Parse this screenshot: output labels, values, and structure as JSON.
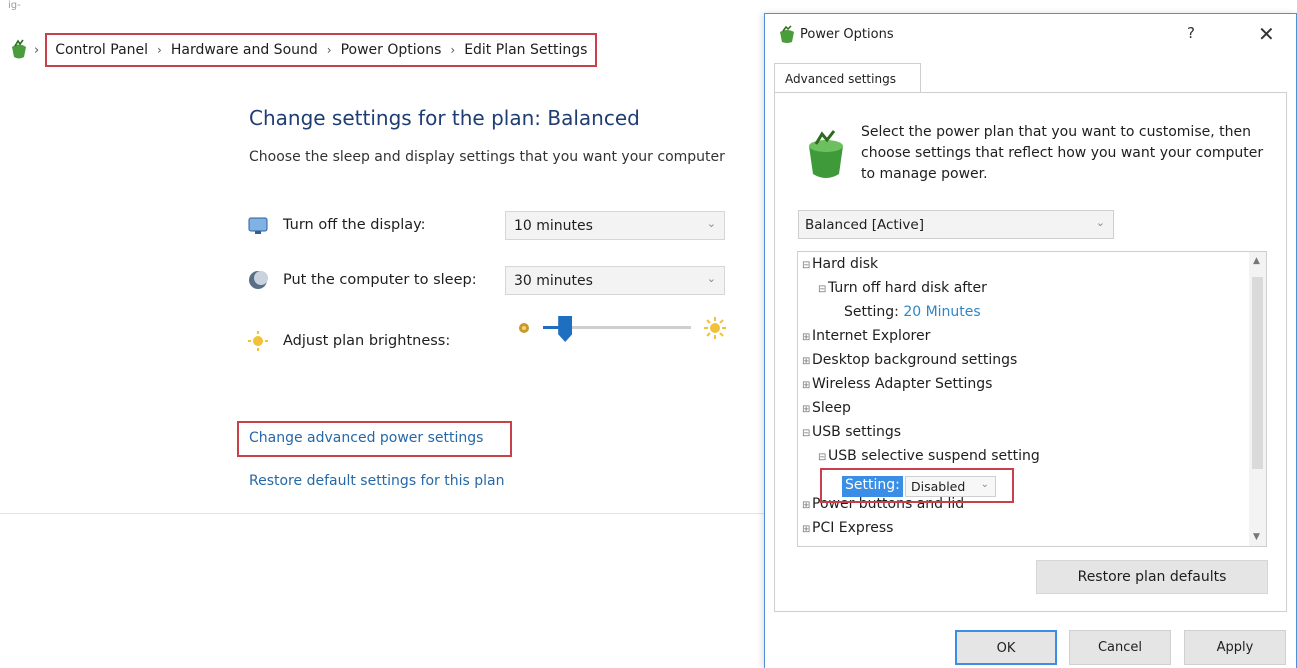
{
  "background": {
    "corner_text": "ig-",
    "breadcrumb": [
      "Control Panel",
      "Hardware and Sound",
      "Power Options",
      "Edit Plan Settings"
    ],
    "title": "Change settings for the plan: Balanced",
    "subtitle": "Choose the sleep and display settings that you want your computer",
    "display_label": "Turn off the display:",
    "display_value": "10 minutes",
    "sleep_label": "Put the computer to sleep:",
    "sleep_value": "30 minutes",
    "brightness_label": "Adjust plan brightness:",
    "brightness_level": 0.15,
    "advanced_link": "Change advanced power settings",
    "restore_link": "Restore default settings for this plan"
  },
  "dialog": {
    "title": "Power Options",
    "help": "?",
    "close": "✕",
    "tab": "Advanced settings",
    "description": "Select the power plan that you want to customise, then choose settings that reflect how you want your computer to manage power.",
    "plan_value": "Balanced [Active]",
    "tree": {
      "hard_disk": "Hard disk",
      "turn_off_hard_disk": "Turn off hard disk after",
      "setting_label": "Setting:",
      "hard_disk_setting_value": "20 Minutes",
      "internet_explorer": "Internet Explorer",
      "desktop_background": "Desktop background settings",
      "wireless_adapter": "Wireless Adapter Settings",
      "sleep": "Sleep",
      "usb_settings": "USB settings",
      "usb_selective": "USB selective suspend setting",
      "usb_setting_label": "Setting:",
      "usb_setting_value": "Disabled",
      "power_buttons": "Power buttons and lid",
      "pci_express": "PCI Express"
    },
    "restore_button": "Restore plan defaults",
    "ok": "OK",
    "cancel": "Cancel",
    "apply": "Apply"
  }
}
